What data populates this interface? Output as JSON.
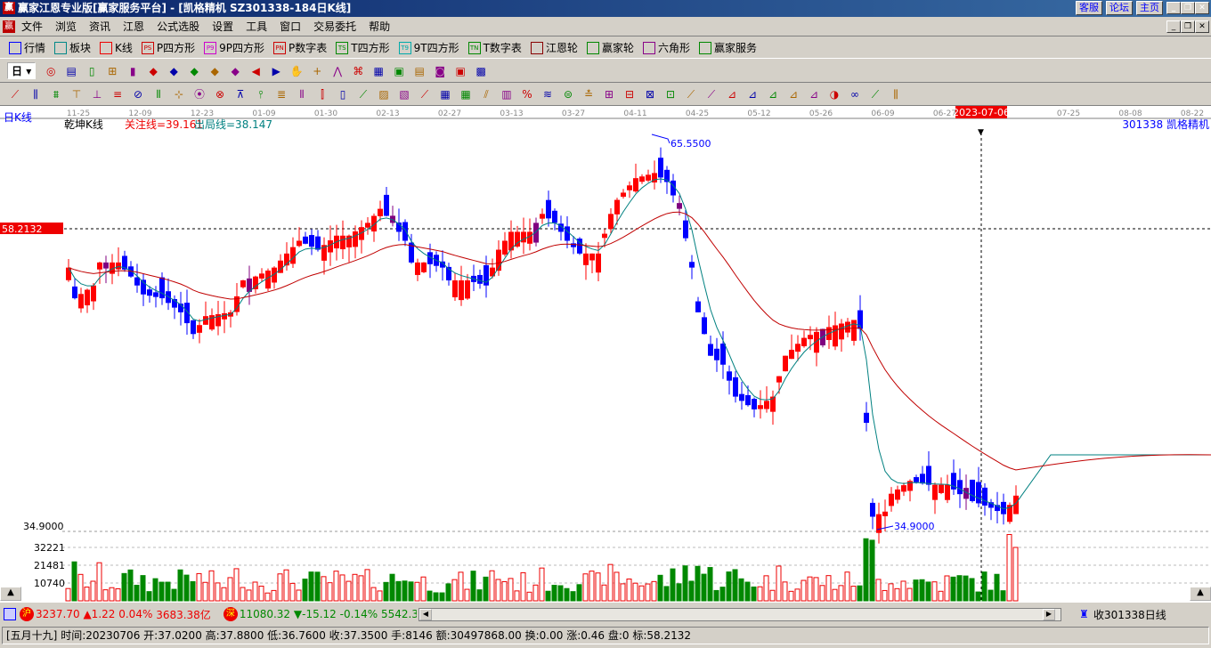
{
  "window": {
    "title": "赢家江恩专业版[赢家服务平台] - [凯格精机   SZ301338-184日K线]",
    "buttons": [
      "客服",
      "论坛",
      "主页"
    ]
  },
  "menu": [
    "文件",
    "浏览",
    "资讯",
    "江恩",
    "公式选股",
    "设置",
    "工具",
    "窗口",
    "交易委托",
    "帮助"
  ],
  "toolbar1": [
    "行情",
    "板块",
    "K线",
    "P四方形",
    "9P四方形",
    "P数字表",
    "T四方形",
    "9T四方形",
    "T数字表",
    "江恩轮",
    "赢家轮",
    "六角形",
    "赢家服务"
  ],
  "toolbar1_icons": [
    "",
    "",
    "",
    "PS",
    "P9",
    "PN",
    "TS",
    "T9",
    "TN",
    "",
    "",
    "",
    ""
  ],
  "period_select": "日",
  "chart": {
    "period_label": "日K线",
    "indicator": "乾坤K线",
    "focus_line": "关注线=39.161",
    "exit_line": "出局线=38.147",
    "stock": "301338  凯格精机",
    "cursor_date": "2023-07-06",
    "crosshair_price": "58.2132",
    "high_label": "65.5500",
    "low_label": "34.9000",
    "low_axis": "34.9000",
    "volume_ticks": [
      "32221",
      "21481",
      "10740"
    ]
  },
  "chart_data": {
    "type": "candlestick",
    "x_ticks": [
      "11-25",
      "12-09",
      "12-23",
      "01-09",
      "01-30",
      "02-13",
      "02-27",
      "03-13",
      "03-27",
      "04-11",
      "04-25",
      "05-12",
      "05-26",
      "06-09",
      "06-27",
      "2023-07-06",
      "07-25",
      "08-08",
      "08-22"
    ],
    "ylim": [
      34.9,
      65.555
    ],
    "close_keypoints": [
      [
        0,
        55.2
      ],
      [
        1,
        52.8
      ],
      [
        4,
        53.8
      ],
      [
        5,
        55.6
      ],
      [
        8,
        55.6
      ],
      [
        10,
        54.5
      ],
      [
        12,
        53.1
      ],
      [
        15,
        52.8
      ],
      [
        18,
        51.7
      ],
      [
        20,
        50.0
      ],
      [
        22,
        51.4
      ],
      [
        26,
        51.7
      ],
      [
        28,
        54.2
      ],
      [
        30,
        54.5
      ],
      [
        33,
        55.2
      ],
      [
        35,
        56.3
      ],
      [
        37,
        57.3
      ],
      [
        40,
        56.6
      ],
      [
        43,
        57.7
      ],
      [
        45,
        57.7
      ],
      [
        48,
        58.7
      ],
      [
        50,
        59.8
      ],
      [
        52,
        58.7
      ],
      [
        54,
        57.3
      ],
      [
        55,
        55.6
      ],
      [
        57,
        55.6
      ],
      [
        60,
        55.2
      ],
      [
        61,
        54.2
      ],
      [
        64,
        54.2
      ],
      [
        67,
        53.8
      ],
      [
        69,
        56.6
      ],
      [
        71,
        58.0
      ],
      [
        74,
        58.0
      ],
      [
        76,
        59.4
      ],
      [
        78,
        58.7
      ],
      [
        80,
        57.3
      ],
      [
        82,
        56.3
      ],
      [
        85,
        56.3
      ],
      [
        87,
        59.4
      ],
      [
        88,
        60.5
      ],
      [
        91,
        62.2
      ],
      [
        94,
        62.6
      ],
      [
        96,
        61.9
      ],
      [
        98,
        59.8
      ],
      [
        100,
        55.2
      ],
      [
        101,
        51.7
      ],
      [
        103,
        48.3
      ],
      [
        105,
        47.6
      ],
      [
        107,
        45.1
      ],
      [
        110,
        44.1
      ],
      [
        113,
        45.1
      ],
      [
        115,
        48.3
      ],
      [
        118,
        49.7
      ],
      [
        121,
        50.4
      ],
      [
        126,
        51.1
      ],
      [
        127,
        50.4
      ],
      [
        129,
        35.7
      ],
      [
        131,
        36.1
      ],
      [
        132,
        37.5
      ],
      [
        135,
        38.5
      ],
      [
        138,
        38.2
      ],
      [
        141,
        38.2
      ],
      [
        144,
        37.1
      ],
      [
        148,
        36.4
      ],
      [
        150,
        35.9
      ],
      [
        152,
        37.35
      ]
    ],
    "last_bar": {
      "lunar": "[五月十九]",
      "time": "20230706",
      "open": "37.0200",
      "high": "37.8800",
      "low": "36.7600",
      "close": "37.3500",
      "hand": "8146",
      "amount": "30497868.00",
      "turnover": "0.00",
      "change": "0.46",
      "pan": "0",
      "mark": "58.2132"
    }
  },
  "status": {
    "sh_icon": "沪",
    "sh": "3237.70",
    "sh_chg": "▲1.22",
    "sh_pct": "0.04%",
    "sh_amt": "3683.38亿",
    "sz_icon": "深",
    "sz": "11080.32",
    "sz_chg": "▼-15.12",
    "sz_pct": "-0.14%",
    "sz_amt": "5542.3",
    "receive": "收301338日线"
  },
  "bottom": {
    "lunar": "[五月十九]",
    "time": "时间:20230706",
    "open": "开:37.0200",
    "high": "高:37.8800",
    "low": "低:36.7600",
    "close": "收:37.3500",
    "hand": "手:8146",
    "amount": "额:30497868.00",
    "turnover": "换:0.00",
    "change": "涨:0.46",
    "pan": "盘:0",
    "mark": "标:58.2132"
  },
  "colors": {
    "up": "#ff0000",
    "down": "#0000ff",
    "focus": "#800080",
    "ma_short": "#008080",
    "ma_long": "#c00000"
  }
}
